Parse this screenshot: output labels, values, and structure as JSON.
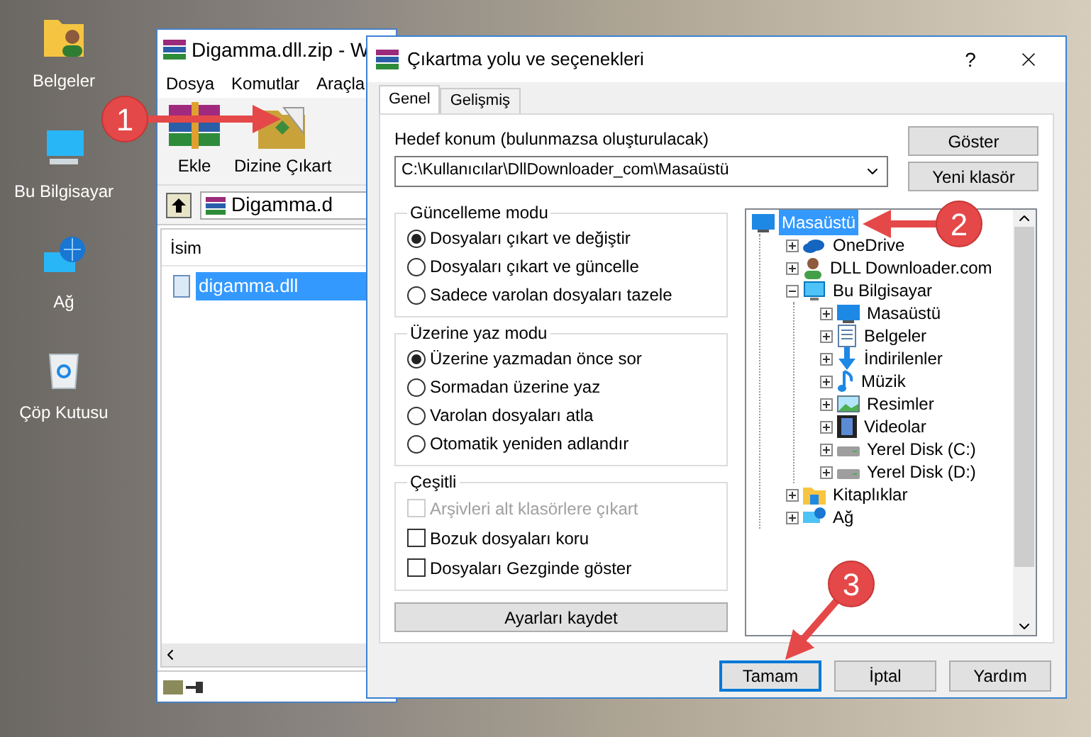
{
  "desktop_icons": [
    {
      "label": "Belgeler",
      "kind": "documents"
    },
    {
      "label": "Bu Bilgisayar",
      "kind": "computer"
    },
    {
      "label": "Ağ",
      "kind": "network"
    },
    {
      "label": "Çöp Kutusu",
      "kind": "recycle"
    }
  ],
  "archive_window": {
    "title": "Digamma.dll.zip - W",
    "menu": [
      "Dosya",
      "Komutlar",
      "Araçla"
    ],
    "toolbar": [
      {
        "label": "Ekle",
        "kind": "add"
      },
      {
        "label": "Dizine Çıkart",
        "kind": "extract"
      }
    ],
    "path": "Digamma.d",
    "column": "İsim",
    "files": [
      {
        "name": "digamma.dll",
        "selected": true
      }
    ]
  },
  "dialog": {
    "title": "Çıkartma yolu ve seçenekleri",
    "help": "?",
    "tabs": [
      {
        "label": "Genel",
        "selected": true
      },
      {
        "label": "Gelişmiş",
        "selected": false
      }
    ],
    "destination_label": "Hedef konum (bulunmazsa oluşturulacak)",
    "destination_value": "C:\\Kullanıcılar\\DllDownloader_com\\Masaüstü",
    "side_buttons": [
      "Göster",
      "Yeni klasör"
    ],
    "groups": [
      {
        "title": "Güncelleme modu",
        "kind": "radio",
        "options": [
          {
            "label": "Dosyaları çıkart ve değiştir",
            "selected": true
          },
          {
            "label": "Dosyaları çıkart ve güncelle",
            "selected": false
          },
          {
            "label": "Sadece varolan dosyaları tazele",
            "selected": false
          }
        ]
      },
      {
        "title": "Üzerine yaz modu",
        "kind": "radio",
        "options": [
          {
            "label": "Üzerine yazmadan önce sor",
            "selected": true
          },
          {
            "label": "Sormadan üzerine yaz",
            "selected": false
          },
          {
            "label": "Varolan dosyaları atla",
            "selected": false
          },
          {
            "label": "Otomatik yeniden adlandır",
            "selected": false
          }
        ]
      },
      {
        "title": "Çeşitli",
        "kind": "checkbox",
        "options": [
          {
            "label": "Arşivleri alt klasörlere çıkart",
            "checked": false,
            "disabled": true
          },
          {
            "label": "Bozuk dosyaları koru",
            "checked": false,
            "disabled": false
          },
          {
            "label": "Dosyaları Gezginde göster",
            "checked": false,
            "disabled": false
          }
        ]
      }
    ],
    "save_button": "Ayarları kaydet",
    "tree": [
      {
        "label": "Masaüstü",
        "kind": "desktop",
        "selected": true,
        "children": [
          {
            "label": "OneDrive",
            "kind": "cloud",
            "selected": false,
            "expanded": false
          },
          {
            "label": "DLL Downloader.com",
            "kind": "user",
            "selected": false,
            "expanded": false
          },
          {
            "label": "Bu Bilgisayar",
            "kind": "computer",
            "selected": false,
            "expanded": true,
            "children": [
              {
                "label": "Masaüstü",
                "kind": "desktop",
                "selected": false,
                "expanded": false
              },
              {
                "label": "Belgeler",
                "kind": "documents",
                "selected": false,
                "expanded": false
              },
              {
                "label": "İndirilenler",
                "kind": "downloads",
                "selected": false,
                "expanded": false
              },
              {
                "label": "Müzik",
                "kind": "music",
                "selected": false,
                "expanded": false
              },
              {
                "label": "Resimler",
                "kind": "pictures",
                "selected": false,
                "expanded": false
              },
              {
                "label": "Videolar",
                "kind": "videos",
                "selected": false,
                "expanded": false
              },
              {
                "label": "Yerel Disk (C:)",
                "kind": "drive",
                "selected": false,
                "expanded": false
              },
              {
                "label": "Yerel Disk (D:)",
                "kind": "drive",
                "selected": false,
                "expanded": false
              }
            ]
          },
          {
            "label": "Kitaplıklar",
            "kind": "library",
            "selected": false,
            "expanded": false
          },
          {
            "label": "Ağ",
            "kind": "network",
            "selected": false,
            "expanded": false
          }
        ]
      }
    ],
    "buttons": [
      {
        "label": "Tamam",
        "focused": true
      },
      {
        "label": "İptal",
        "focused": false
      },
      {
        "label": "Yardım",
        "focused": false
      }
    ]
  },
  "callouts": [
    "1",
    "2",
    "3"
  ]
}
